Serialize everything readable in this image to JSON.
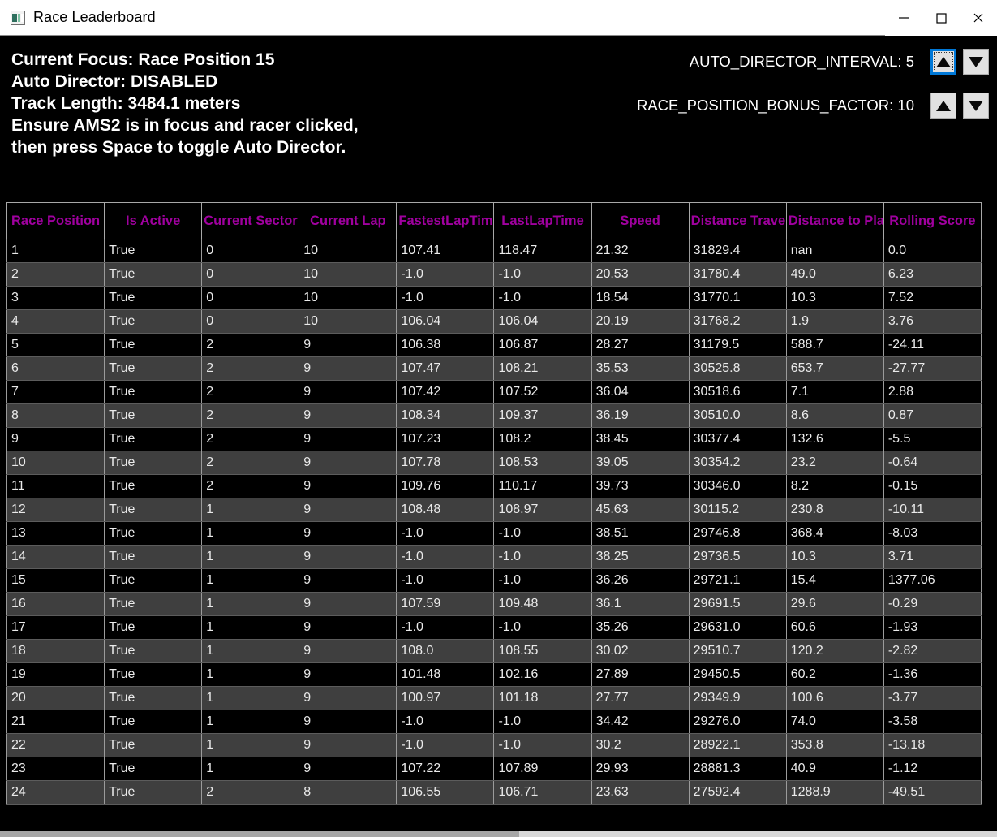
{
  "window": {
    "title": "Race Leaderboard",
    "icon": "app-icon",
    "minimize_label": "—",
    "maximize_label": "□",
    "close_label": "✕"
  },
  "header": {
    "lines": [
      "Current Focus: Race Position 15",
      "Auto Director: DISABLED",
      "Track Length: 3484.1 meters",
      "Ensure AMS2 is in focus and racer clicked,",
      "then press Space to toggle Auto Director."
    ],
    "controls": [
      {
        "label": "AUTO_DIRECTOR_INTERVAL: 5",
        "up": "▲",
        "down": "▼",
        "focused": true
      },
      {
        "label": "RACE_POSITION_BONUS_FACTOR: 10",
        "up": "▲",
        "down": "▼",
        "focused": false
      }
    ]
  },
  "colors": {
    "header_text": "#a0009f",
    "cell_text": "#eaeaea",
    "row_odd": "#000000",
    "row_even": "#3f3f3f",
    "focus_ring": "#0078d7",
    "background": "#000000"
  },
  "table": {
    "columns": [
      "Race Position",
      "Is Active",
      "Current Sector",
      "Current Lap",
      "FastestLapTime",
      "LastLapTime",
      "Speed",
      "Distance Travelled",
      "Distance to Player Ahead",
      "Rolling Score"
    ],
    "rows": [
      [
        "1",
        "True",
        "0",
        "10",
        "107.41",
        "118.47",
        "21.32",
        "31829.4",
        "nan",
        "0.0"
      ],
      [
        "2",
        "True",
        "0",
        "10",
        "-1.0",
        "-1.0",
        "20.53",
        "31780.4",
        "49.0",
        "6.23"
      ],
      [
        "3",
        "True",
        "0",
        "10",
        "-1.0",
        "-1.0",
        "18.54",
        "31770.1",
        "10.3",
        "7.52"
      ],
      [
        "4",
        "True",
        "0",
        "10",
        "106.04",
        "106.04",
        "20.19",
        "31768.2",
        "1.9",
        "3.76"
      ],
      [
        "5",
        "True",
        "2",
        "9",
        "106.38",
        "106.87",
        "28.27",
        "31179.5",
        "588.7",
        "-24.11"
      ],
      [
        "6",
        "True",
        "2",
        "9",
        "107.47",
        "108.21",
        "35.53",
        "30525.8",
        "653.7",
        "-27.77"
      ],
      [
        "7",
        "True",
        "2",
        "9",
        "107.42",
        "107.52",
        "36.04",
        "30518.6",
        "7.1",
        "2.88"
      ],
      [
        "8",
        "True",
        "2",
        "9",
        "108.34",
        "109.37",
        "36.19",
        "30510.0",
        "8.6",
        "0.87"
      ],
      [
        "9",
        "True",
        "2",
        "9",
        "107.23",
        "108.2",
        "38.45",
        "30377.4",
        "132.6",
        "-5.5"
      ],
      [
        "10",
        "True",
        "2",
        "9",
        "107.78",
        "108.53",
        "39.05",
        "30354.2",
        "23.2",
        "-0.64"
      ],
      [
        "11",
        "True",
        "2",
        "9",
        "109.76",
        "110.17",
        "39.73",
        "30346.0",
        "8.2",
        "-0.15"
      ],
      [
        "12",
        "True",
        "1",
        "9",
        "108.48",
        "108.97",
        "45.63",
        "30115.2",
        "230.8",
        "-10.11"
      ],
      [
        "13",
        "True",
        "1",
        "9",
        "-1.0",
        "-1.0",
        "38.51",
        "29746.8",
        "368.4",
        "-8.03"
      ],
      [
        "14",
        "True",
        "1",
        "9",
        "-1.0",
        "-1.0",
        "38.25",
        "29736.5",
        "10.3",
        "3.71"
      ],
      [
        "15",
        "True",
        "1",
        "9",
        "-1.0",
        "-1.0",
        "36.26",
        "29721.1",
        "15.4",
        "1377.06"
      ],
      [
        "16",
        "True",
        "1",
        "9",
        "107.59",
        "109.48",
        "36.1",
        "29691.5",
        "29.6",
        "-0.29"
      ],
      [
        "17",
        "True",
        "1",
        "9",
        "-1.0",
        "-1.0",
        "35.26",
        "29631.0",
        "60.6",
        "-1.93"
      ],
      [
        "18",
        "True",
        "1",
        "9",
        "108.0",
        "108.55",
        "30.02",
        "29510.7",
        "120.2",
        "-2.82"
      ],
      [
        "19",
        "True",
        "1",
        "9",
        "101.48",
        "102.16",
        "27.89",
        "29450.5",
        "60.2",
        "-1.36"
      ],
      [
        "20",
        "True",
        "1",
        "9",
        "100.97",
        "101.18",
        "27.77",
        "29349.9",
        "100.6",
        "-3.77"
      ],
      [
        "21",
        "True",
        "1",
        "9",
        "-1.0",
        "-1.0",
        "34.42",
        "29276.0",
        "74.0",
        "-3.58"
      ],
      [
        "22",
        "True",
        "1",
        "9",
        "-1.0",
        "-1.0",
        "30.2",
        "28922.1",
        "353.8",
        "-13.18"
      ],
      [
        "23",
        "True",
        "1",
        "9",
        "107.22",
        "107.89",
        "29.93",
        "28881.3",
        "40.9",
        "-1.12"
      ],
      [
        "24",
        "True",
        "2",
        "8",
        "106.55",
        "106.71",
        "23.63",
        "27592.4",
        "1288.9",
        "-49.51"
      ]
    ]
  }
}
